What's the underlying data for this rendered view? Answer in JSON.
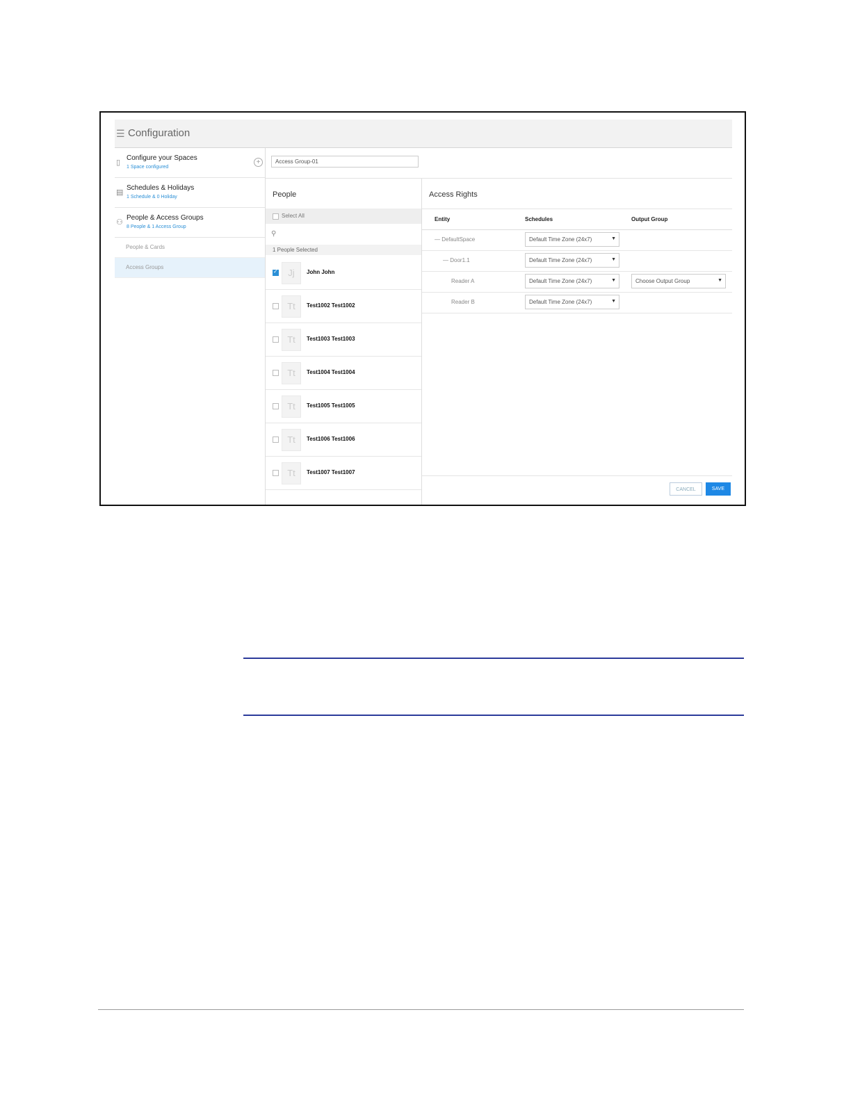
{
  "app": {
    "title": "Configuration"
  },
  "sidebar": {
    "items": [
      {
        "title": "Configure your Spaces",
        "subtitle": "1 Space configured",
        "has_add": true
      },
      {
        "title": "Schedules & Holidays",
        "subtitle": "1 Schedule & 0 Holiday"
      },
      {
        "title": "People & Access Groups",
        "subtitle": "8 People & 1 Access Group"
      }
    ],
    "subitems": [
      {
        "label": "People & Cards",
        "active": false
      },
      {
        "label": "Access Groups",
        "active": true
      }
    ]
  },
  "group_name": {
    "value": "Access Group-01"
  },
  "people": {
    "header": "People",
    "select_all": "Select All",
    "selected_count": "1 People Selected",
    "rows": [
      {
        "initials": "Jj",
        "name": "John John",
        "checked": true
      },
      {
        "initials": "Tt",
        "name": "Test1002 Test1002",
        "checked": false
      },
      {
        "initials": "Tt",
        "name": "Test1003 Test1003",
        "checked": false
      },
      {
        "initials": "Tt",
        "name": "Test1004 Test1004",
        "checked": false
      },
      {
        "initials": "Tt",
        "name": "Test1005 Test1005",
        "checked": false
      },
      {
        "initials": "Tt",
        "name": "Test1006 Test1006",
        "checked": false
      },
      {
        "initials": "Tt",
        "name": "Test1007 Test1007",
        "checked": false
      }
    ]
  },
  "access_rights": {
    "header": "Access Rights",
    "columns": [
      "Entity",
      "Schedules",
      "Output Group"
    ],
    "rows": [
      {
        "entity": "— DefaultSpace",
        "schedule": "Default Time Zone (24x7)",
        "output_group": ""
      },
      {
        "entity": "— Door1.1",
        "schedule": "Default Time Zone (24x7)",
        "output_group": ""
      },
      {
        "entity": "Reader A",
        "schedule": "Default Time Zone (24x7)",
        "output_group": "Choose Output Group"
      },
      {
        "entity": "Reader B",
        "schedule": "Default Time Zone (24x7)",
        "output_group": ""
      }
    ]
  },
  "actions": {
    "cancel": "CANCEL",
    "save": "SAVE"
  },
  "colors": {
    "accent": "#1e88e5",
    "link": "#2a8fd6",
    "active_bg": "#e6f2fb",
    "doc_rule": "#2b3a9a"
  }
}
